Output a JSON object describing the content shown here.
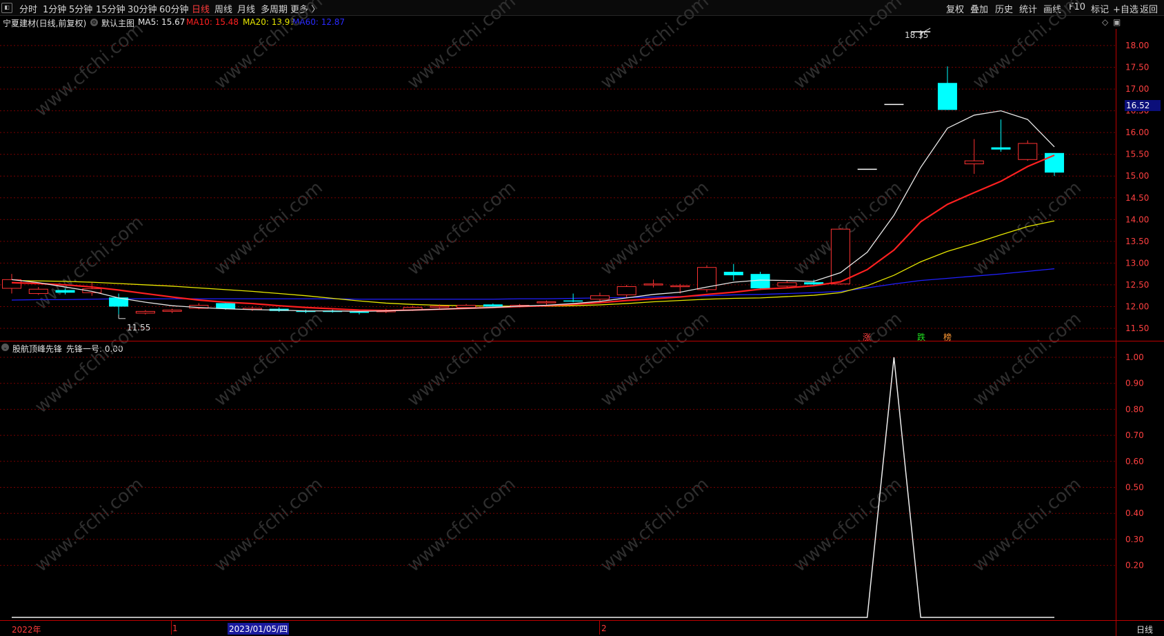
{
  "toolbar": {
    "periods": [
      "分时",
      "1分钟",
      "5分钟",
      "15分钟",
      "30分钟",
      "60分钟",
      "日线",
      "周线",
      "月线",
      "多周期",
      "更多 〉"
    ],
    "active_period": "日线",
    "right": [
      "复权",
      "叠加",
      "历史",
      "统计",
      "画线",
      "F10",
      "标记",
      "+自选",
      "返回"
    ]
  },
  "main_legend": {
    "stock": "宁夏建材(日线,前复权)",
    "chart_name": "默认主图",
    "ma5": "MA5: 15.67",
    "ma10": "MA10: 15.48",
    "ma20": "MA20: 13.97",
    "ma60": "MA60: 12.87"
  },
  "sub_legend": {
    "indicator": "股航顶峰先锋",
    "value": "先锋一号: 0.00"
  },
  "annotations": {
    "high": "18.35",
    "low": "11.55",
    "current_price": "16.52",
    "tag_rise": "涨",
    "tag_fall": "跌",
    "tag_rank": "榜"
  },
  "bottom": {
    "year": "2022年",
    "m1": "1",
    "cursor_date": "2023/01/05/四",
    "m2": "2",
    "period": "日线"
  },
  "colors": {
    "up": "#ff3232",
    "down": "#00ffff",
    "ma5": "#e8e8e8",
    "ma10": "#ff2020",
    "ma20": "#e8e800",
    "ma60": "#2020ff",
    "grid": "#7a0000",
    "axis": "#c00000"
  },
  "chart_data": [
    {
      "type": "candlestick",
      "title": "宁夏建材(日线,前复权)",
      "y_ticks": [
        11.5,
        12.0,
        12.5,
        13.0,
        13.5,
        14.0,
        14.5,
        15.0,
        15.5,
        16.0,
        16.5,
        17.0,
        17.5,
        18.0
      ],
      "ylim": [
        11.25,
        18.35
      ],
      "candles": [
        [
          12.42,
          12.62,
          12.3,
          12.75
        ],
        [
          12.3,
          12.4,
          12.27,
          12.45
        ],
        [
          12.38,
          12.32,
          12.28,
          12.42
        ],
        [
          12.32,
          12.41,
          12.25,
          12.55
        ],
        [
          12.21,
          12.0,
          11.82,
          12.3
        ],
        [
          11.85,
          11.89,
          11.82,
          11.92
        ],
        [
          11.89,
          11.92,
          11.85,
          11.95
        ],
        [
          11.96,
          12.03,
          11.94,
          12.08
        ],
        [
          12.08,
          11.95,
          11.93,
          12.1
        ],
        [
          11.95,
          11.96,
          11.9,
          12.0
        ],
        [
          11.95,
          11.9,
          11.88,
          11.98
        ],
        [
          11.9,
          11.89,
          11.85,
          11.93
        ],
        [
          11.9,
          11.88,
          11.86,
          11.93
        ],
        [
          11.88,
          11.87,
          11.82,
          11.92
        ],
        [
          11.88,
          11.91,
          11.85,
          11.95
        ],
        [
          11.92,
          11.98,
          11.9,
          12.02
        ],
        [
          11.99,
          12.01,
          11.96,
          12.05
        ],
        [
          11.98,
          12.03,
          11.96,
          12.06
        ],
        [
          12.05,
          12.0,
          11.97,
          12.07
        ],
        [
          12.0,
          12.03,
          11.98,
          12.06
        ],
        [
          12.09,
          12.11,
          12.04,
          12.14
        ],
        [
          12.14,
          12.13,
          12.1,
          12.3
        ],
        [
          12.17,
          12.25,
          12.12,
          12.32
        ],
        [
          12.27,
          12.46,
          12.2,
          12.5
        ],
        [
          12.5,
          12.52,
          12.44,
          12.62
        ],
        [
          12.46,
          12.48,
          12.3,
          12.52
        ],
        [
          12.39,
          12.9,
          12.33,
          12.95
        ],
        [
          12.8,
          12.72,
          12.6,
          12.98
        ],
        [
          12.75,
          12.42,
          12.38,
          12.8
        ],
        [
          12.47,
          12.55,
          12.43,
          12.6
        ],
        [
          12.56,
          12.51,
          12.49,
          12.62
        ],
        [
          12.52,
          13.78,
          12.5,
          13.8
        ],
        [
          15.16,
          15.16,
          15.16,
          15.16
        ],
        [
          16.65,
          16.65,
          16.65,
          16.65
        ],
        [
          18.32,
          18.32,
          18.15,
          18.35
        ],
        [
          17.14,
          16.52,
          16.52,
          17.52
        ],
        [
          15.28,
          15.35,
          15.05,
          15.85
        ],
        [
          15.66,
          15.61,
          15.56,
          16.3
        ],
        [
          15.38,
          15.75,
          15.35,
          15.82
        ],
        [
          15.53,
          15.08,
          15.0,
          15.53
        ]
      ],
      "ma5": [
        12.62,
        12.55,
        12.45,
        12.35,
        12.2,
        12.1,
        12.02,
        11.98,
        11.95,
        11.93,
        11.92,
        11.9,
        11.9,
        11.89,
        11.9,
        11.92,
        11.94,
        11.96,
        11.98,
        12.01,
        12.03,
        12.07,
        12.12,
        12.2,
        12.28,
        12.33,
        12.45,
        12.56,
        12.61,
        12.6,
        12.58,
        12.78,
        13.25,
        14.1,
        15.2,
        16.1,
        16.4,
        16.5,
        16.3,
        15.67
      ],
      "ma10": [
        12.55,
        12.53,
        12.5,
        12.45,
        12.38,
        12.3,
        12.22,
        12.15,
        12.1,
        12.07,
        12.02,
        11.98,
        11.95,
        11.92,
        11.91,
        11.92,
        11.94,
        11.96,
        11.98,
        12.0,
        12.02,
        12.05,
        12.09,
        12.14,
        12.18,
        12.22,
        12.28,
        12.33,
        12.4,
        12.43,
        12.48,
        12.57,
        12.85,
        13.3,
        13.95,
        14.35,
        14.62,
        14.88,
        15.22,
        15.48
      ],
      "ma20": [
        12.6,
        12.59,
        12.58,
        12.56,
        12.53,
        12.5,
        12.47,
        12.43,
        12.39,
        12.35,
        12.3,
        12.25,
        12.19,
        12.13,
        12.08,
        12.05,
        12.03,
        12.02,
        12.01,
        12.01,
        12.01,
        12.02,
        12.04,
        12.07,
        12.11,
        12.14,
        12.17,
        12.19,
        12.2,
        12.23,
        12.26,
        12.32,
        12.48,
        12.72,
        13.03,
        13.27,
        13.45,
        13.65,
        13.84,
        13.97
      ],
      "ma60": [
        12.15,
        12.16,
        12.16,
        12.17,
        12.18,
        12.18,
        12.18,
        12.18,
        12.18,
        12.18,
        12.18,
        12.18,
        12.18,
        12.17,
        12.17,
        12.17,
        12.17,
        12.17,
        12.17,
        12.18,
        12.18,
        12.19,
        12.2,
        12.21,
        12.22,
        12.23,
        12.25,
        12.27,
        12.28,
        12.3,
        12.32,
        12.35,
        12.43,
        12.52,
        12.6,
        12.65,
        12.7,
        12.75,
        12.81,
        12.87
      ],
      "signal_tags": [
        "涨",
        "跌",
        "榜"
      ]
    },
    {
      "type": "line",
      "title": "股航顶峰先锋",
      "series": [
        {
          "name": "先锋一号",
          "values": [
            0,
            0,
            0,
            0,
            0,
            0,
            0,
            0,
            0,
            0,
            0,
            0,
            0,
            0,
            0,
            0,
            0,
            0,
            0,
            0,
            0,
            0,
            0,
            0,
            0,
            0,
            0,
            0,
            0,
            0,
            0,
            0,
            0,
            1,
            0,
            0,
            0,
            0,
            0,
            0
          ]
        }
      ],
      "y_ticks": [
        0.2,
        0.3,
        0.4,
        0.5,
        0.6,
        0.7,
        0.8,
        0.9,
        1.0
      ],
      "ylim": [
        0,
        1.04
      ],
      "xlabels": [
        "2022年",
        "1",
        "2023/01/05/四",
        "2"
      ]
    }
  ]
}
